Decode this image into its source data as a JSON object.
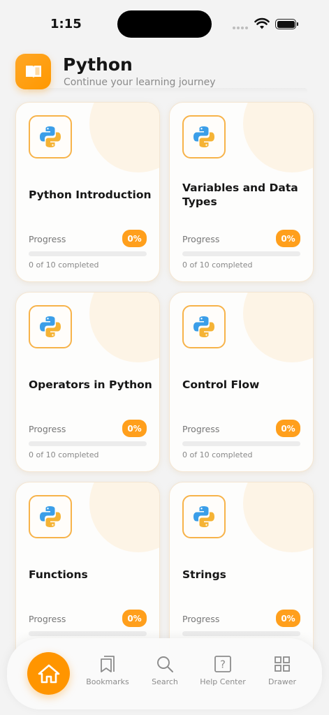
{
  "status_bar": {
    "time": "1:15"
  },
  "header": {
    "title": "Python",
    "subtitle": "Continue your learning journey"
  },
  "colors": {
    "accent": "#ff9f1c",
    "nav_home": "#ff9500"
  },
  "cards": [
    {
      "title": "Python Introduction",
      "progress_label": "Progress",
      "percent_text": "0%",
      "progress": 0,
      "completed": "0 of 10 completed"
    },
    {
      "title": "Variables and Data Types",
      "progress_label": "Progress",
      "percent_text": "0%",
      "progress": 0,
      "completed": "0 of 10 completed"
    },
    {
      "title": "Operators in Python",
      "progress_label": "Progress",
      "percent_text": "0%",
      "progress": 0,
      "completed": "0 of 10 completed"
    },
    {
      "title": "Control Flow",
      "progress_label": "Progress",
      "percent_text": "0%",
      "progress": 0,
      "completed": "0 of 10 completed"
    },
    {
      "title": "Functions",
      "progress_label": "Progress",
      "percent_text": "0%",
      "progress": 0,
      "completed": ""
    },
    {
      "title": "Strings",
      "progress_label": "Progress",
      "percent_text": "0%",
      "progress": 0,
      "completed": ""
    }
  ],
  "nav": {
    "home_icon": "home-icon",
    "items": [
      {
        "label": "Bookmarks",
        "icon": "bookmarks-icon"
      },
      {
        "label": "Search",
        "icon": "search-icon"
      },
      {
        "label": "Help Center",
        "icon": "help-icon"
      },
      {
        "label": "Drawer",
        "icon": "grid-icon"
      }
    ]
  }
}
